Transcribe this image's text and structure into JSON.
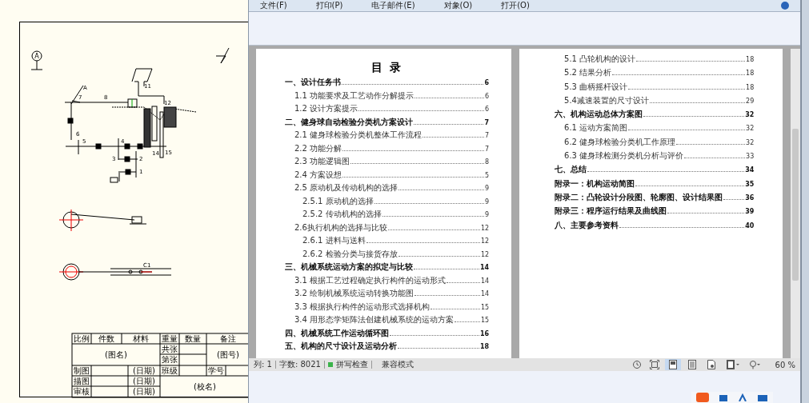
{
  "cad": {
    "datum_label": "A",
    "labels": [
      "A",
      "7",
      "8",
      "11",
      "12",
      "6",
      "5",
      "4",
      "3",
      "2",
      "1",
      "14",
      "15",
      "C1"
    ],
    "title_block": {
      "row1": [
        "比例",
        "件数",
        "材料",
        "重量",
        "数量",
        "备注"
      ],
      "drawing_name": "(图名)",
      "sheet_labels": [
        "共张",
        "第张"
      ],
      "drawing_number": "(图号)",
      "people": [
        {
          "role": "制图",
          "date": "(日期)"
        },
        {
          "role": "描图",
          "date": "(日期)"
        },
        {
          "role": "审核",
          "date": "(日期)"
        }
      ],
      "class_label": "班级",
      "student_label": "学号",
      "school": "(校名)"
    }
  },
  "menu": [
    {
      "label": "文件(F)"
    },
    {
      "label": "打印(P)"
    },
    {
      "label": "电子邮件(E)"
    },
    {
      "label": "对象(O)"
    },
    {
      "label": "打开(O)"
    }
  ],
  "pages": [
    {
      "title": "目 录",
      "entries": [
        {
          "kind": "chapter",
          "text": "一、设计任务书",
          "page": "6"
        },
        {
          "kind": "section",
          "text": "1.1 功能要求及工艺动作分解提示",
          "page": "6"
        },
        {
          "kind": "section",
          "text": "1.2 设计方案提示",
          "page": "6"
        },
        {
          "kind": "chapter",
          "text": "二、健身球自动检验分类机方案设计",
          "page": "7"
        },
        {
          "kind": "section",
          "text": "2.1 健身球检验分类机整体工作流程",
          "page": "7"
        },
        {
          "kind": "section",
          "text": "2.2 功能分解",
          "page": "7"
        },
        {
          "kind": "section",
          "text": "2.3 功能逻辑图",
          "page": "8"
        },
        {
          "kind": "section",
          "text": "2.4 方案设想",
          "page": "5"
        },
        {
          "kind": "section",
          "text": "2.5 原动机及传动机构的选择",
          "page": "9"
        },
        {
          "kind": "subsection",
          "text": "2.5.1 原动机的选择",
          "page": "9"
        },
        {
          "kind": "subsection",
          "text": "2.5.2 传动机构的选择",
          "page": "9"
        },
        {
          "kind": "section",
          "text": "2.6执行机构的选择与比较",
          "page": "12"
        },
        {
          "kind": "subsection",
          "text": "2.6.1 进料与送料",
          "page": "12"
        },
        {
          "kind": "subsection",
          "text": "2.6.2 检验分类与接货存放",
          "page": "12"
        },
        {
          "kind": "chapter",
          "text": "三、机械系统运动方案的拟定与比较",
          "page": "14"
        },
        {
          "kind": "section",
          "text": "3.1 根据工艺过程确定执行构件的运动形式",
          "page": "14"
        },
        {
          "kind": "section",
          "text": "3.2 绘制机械系统运动转换功能图",
          "page": "14"
        },
        {
          "kind": "section",
          "text": "3.3 根据执行构件的运动形式选择机构",
          "page": "15"
        },
        {
          "kind": "section",
          "text": "3.4 用形态学矩阵法创建机械系统的运动方案",
          "page": "15"
        },
        {
          "kind": "chapter",
          "text": "四、机械系统工作运动循环图",
          "page": "16"
        },
        {
          "kind": "chapter",
          "text": "五、机构的尺寸设计及运动分析",
          "page": "18"
        }
      ]
    },
    {
      "entries": [
        {
          "kind": "section",
          "text": "5.1 凸轮机构的设计",
          "page": "18"
        },
        {
          "kind": "section",
          "text": "5.2 结果分析",
          "page": "18"
        },
        {
          "kind": "section",
          "text": "5.3 曲柄摇杆设计",
          "page": "18"
        },
        {
          "kind": "section",
          "text": "5.4减速装置的尺寸设计",
          "page": "29"
        },
        {
          "kind": "chapter",
          "text": "六、机构运动总体方案图",
          "page": "32"
        },
        {
          "kind": "section",
          "text": "6.1 运动方案简图",
          "page": "32"
        },
        {
          "kind": "section",
          "text": "6.2 健身球检验分类机工作原理",
          "page": "32"
        },
        {
          "kind": "section",
          "text": "6.3 健身球检测分类机分析与评价",
          "page": "33"
        },
        {
          "kind": "chapter",
          "text": "七、总结",
          "page": "34"
        },
        {
          "kind": "chapter",
          "text": "附录一：机构运动简图",
          "page": "35"
        },
        {
          "kind": "chapter",
          "text": "附录二：凸轮设计分段图、轮廓图、设计结果图",
          "page": "36"
        },
        {
          "kind": "chapter",
          "text": "附录三：程序运行结果及曲线图",
          "page": "39"
        },
        {
          "kind": "chapter",
          "text": "八、主要参考资料",
          "page": "40"
        }
      ]
    }
  ],
  "status_bar": {
    "column": "列: 1",
    "word_count": "字数: 8021",
    "spell_check": {
      "label": "拼写检查",
      "on": true
    },
    "mode": "兼容模式",
    "view_buttons": [
      {
        "kind": "page",
        "selected": true
      },
      {
        "kind": "outline",
        "selected": false
      },
      {
        "kind": "web",
        "selected": false
      },
      {
        "kind": "read",
        "selected": false
      }
    ],
    "zoom": "60 %"
  }
}
